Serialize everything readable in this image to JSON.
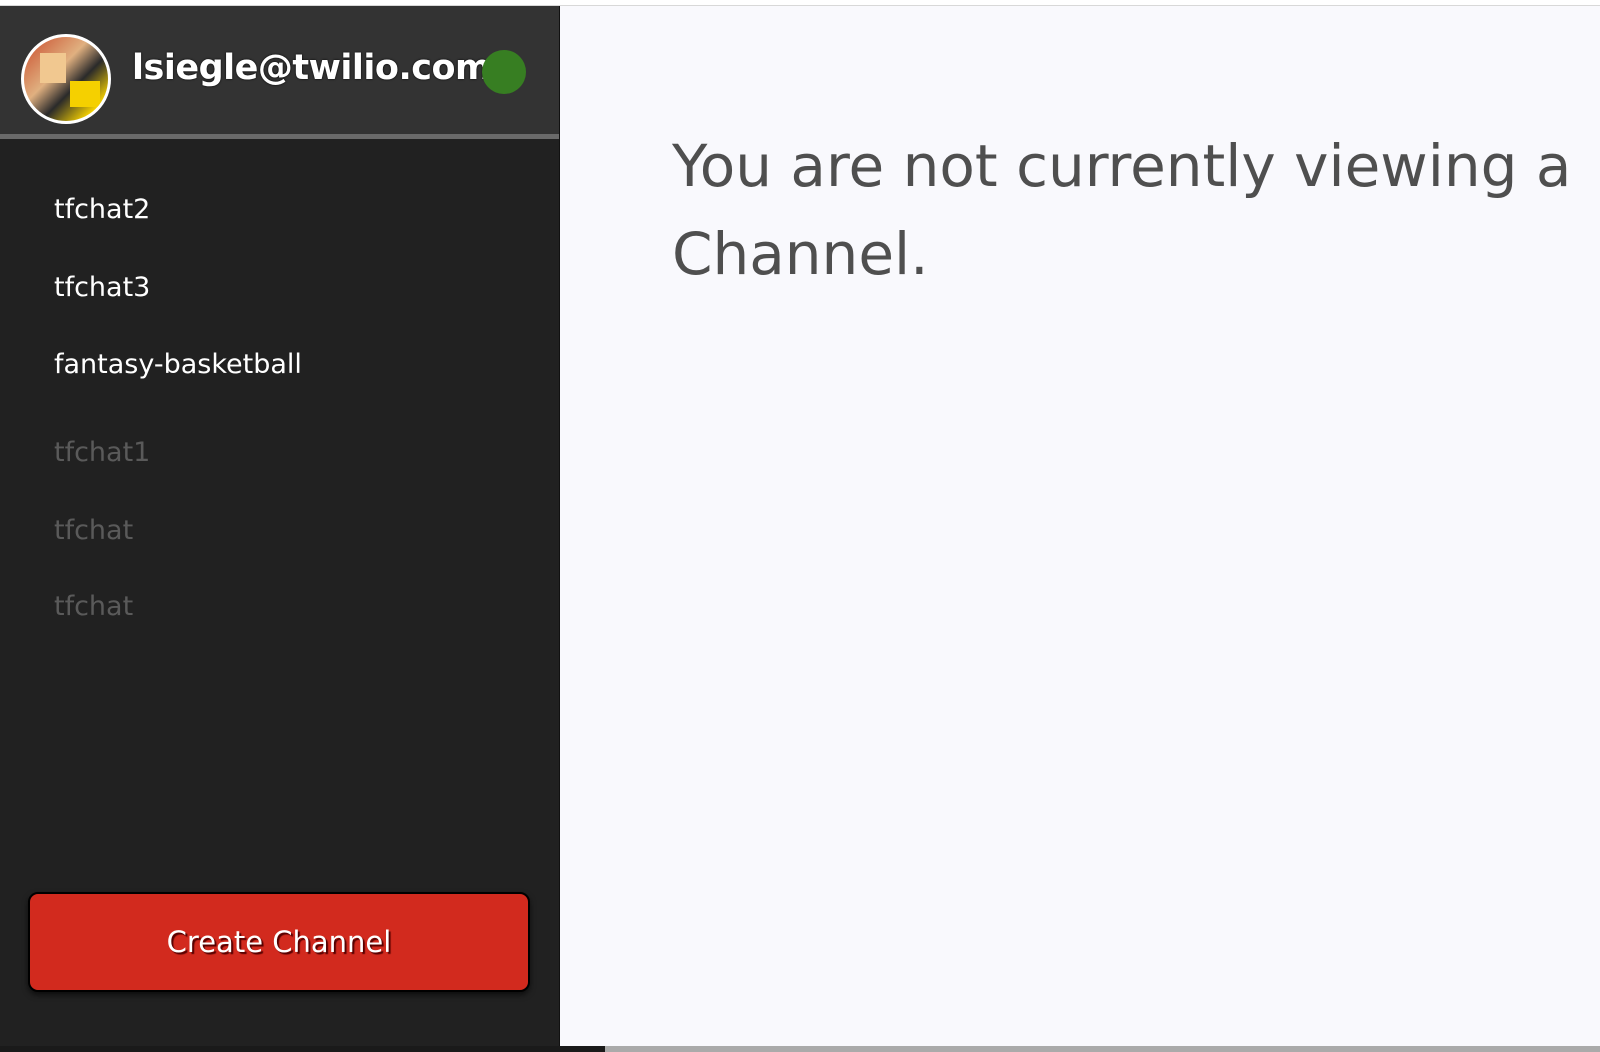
{
  "user": {
    "email": "lsiegle@twilio.com",
    "status_color": "#377e22",
    "status": "online"
  },
  "channels": [
    {
      "label": "tfchat2",
      "joined": true
    },
    {
      "label": "tfchat3",
      "joined": true
    },
    {
      "label": "fantasy-basketball",
      "joined": true
    },
    {
      "label": "tfchat1",
      "joined": false
    },
    {
      "label": "tfchat",
      "joined": false
    },
    {
      "label": "tfchat",
      "joined": false
    }
  ],
  "create_button": {
    "label": "Create Channel",
    "color": "#d22a1e"
  },
  "main": {
    "message": "You are not currently viewing a Channel."
  }
}
